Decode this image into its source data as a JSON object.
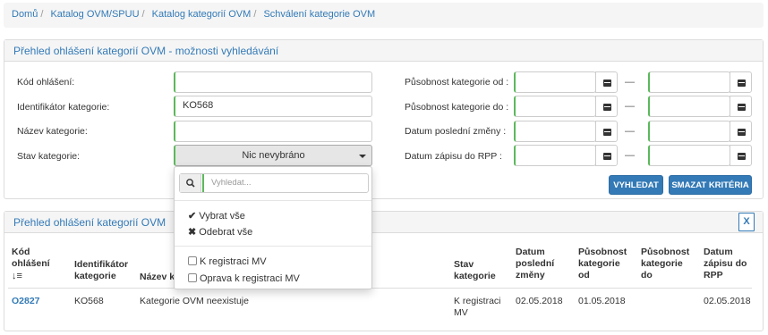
{
  "breadcrumb": [
    "Domů",
    "Katalog OVM/SPUU",
    "Katalog kategorií OVM",
    "Schválení kategorie OVM"
  ],
  "search_panel": {
    "title": "Přehled ohlášení kategorií OVM - možnosti vyhledávání",
    "fields": {
      "kod_label": "Kód ohlášení:",
      "kod_value": "",
      "ident_label": "Identifikátor kategorie:",
      "ident_value": "KO568",
      "nazev_label": "Název kategorie:",
      "nazev_value": "",
      "stav_label": "Stav kategorie:",
      "stav_value": "Nic nevybráno",
      "pusobnost_od_label": "Působnost kategorie od :",
      "pusobnost_do_label": "Působnost kategorie do :",
      "datum_zmeny_label": "Datum poslední změny :",
      "datum_zapisu_label": "Datum zápisu do RPP :",
      "range_separator": "—"
    },
    "buttons": {
      "search": "VYHLEDAT",
      "clear": "SMAZAT KRITÉRIA"
    }
  },
  "dropdown": {
    "search_placeholder": "Vyhledat...",
    "select_all": "Vybrat vše",
    "deselect_all": "Odebrat vše",
    "options": [
      "K registraci MV",
      "Oprava k registraci MV"
    ]
  },
  "results_panel": {
    "title": "Přehled ohlášení kategorií OVM",
    "export_icon": "excel-export-icon",
    "columns": {
      "kod": "Kód ohlášení",
      "ident": "Identifikátor kategorie",
      "nazev": "Název kategorie",
      "stav": "Stav kategorie",
      "datum_zmeny": "Datum poslední změny",
      "pusobnost_od": "Působnost kategorie od",
      "pusobnost_do": "Působnost kategorie do",
      "datum_zapisu": "Datum zápisu do RPP"
    },
    "rows": [
      {
        "kod": "O2827",
        "ident": "KO568",
        "nazev": "Kategorie OVM neexistuje",
        "stav": "K registraci MV",
        "datum_zmeny": "02.05.2018",
        "pusobnost_od": "01.05.2018",
        "pusobnost_do": "",
        "datum_zapisu": "02.05.2018"
      }
    ]
  },
  "colors": {
    "link": "#337ab7",
    "primary": "#337ab7",
    "valid_border": "#5cb85c"
  }
}
